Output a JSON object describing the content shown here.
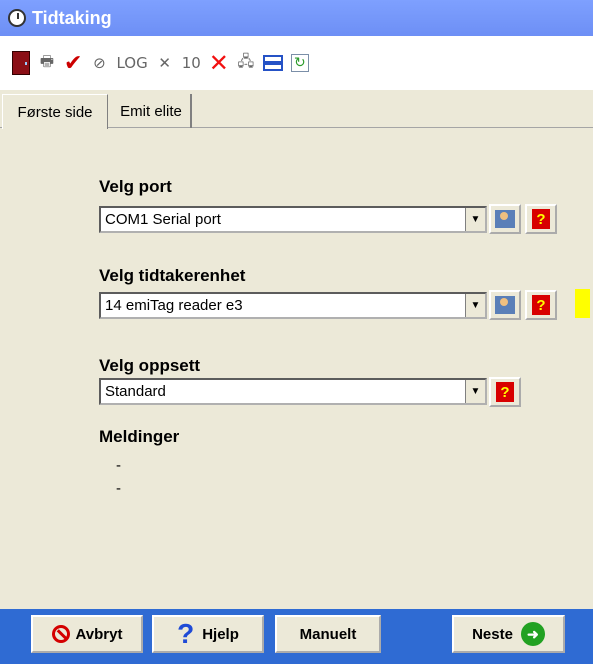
{
  "window": {
    "title": "Tidtaking"
  },
  "toolbar": {
    "log_label": "LOG",
    "count_label": "10"
  },
  "tabs": [
    {
      "label": "Første side"
    },
    {
      "label": "Emit elite"
    }
  ],
  "form": {
    "port_label": "Velg port",
    "port_value": "COM1 Serial port",
    "unit_label": "Velg tidtakerenhet",
    "unit_value": "14 emiTag reader e3",
    "setup_label": "Velg oppsett",
    "setup_value": "Standard",
    "messages_label": "Meldinger",
    "messages": [
      "-",
      "-"
    ]
  },
  "footer": {
    "cancel_label": "Avbryt",
    "help_label": "Hjelp",
    "manual_label": "Manuelt",
    "next_label": "Neste"
  }
}
